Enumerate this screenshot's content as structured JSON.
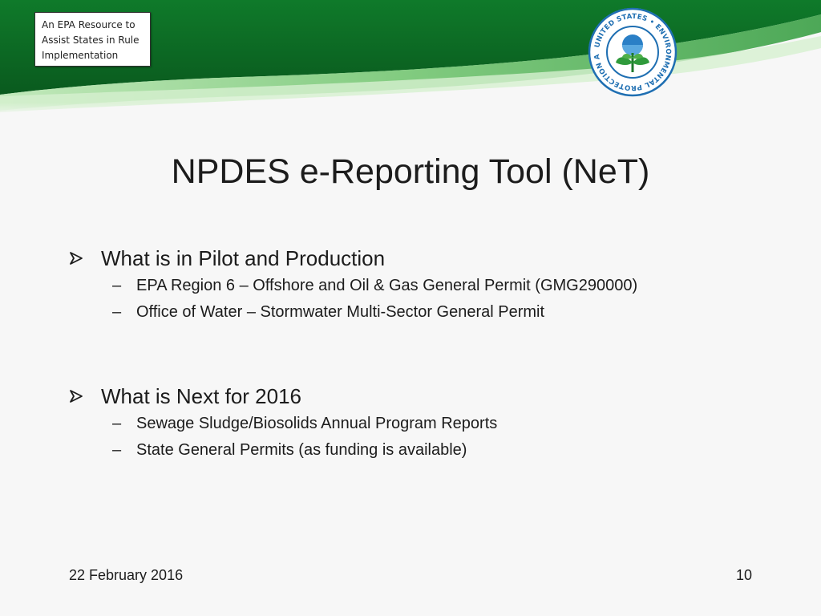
{
  "header": {
    "resource_note": {
      "line1": "An EPA Resource to",
      "line2": "Assist States in Rule",
      "line3": "Implementation"
    },
    "seal": {
      "ring_text": "UNITED STATES • ENVIRONMENTAL PROTECTION AGENCY •",
      "icon": "epa-seal-icon"
    },
    "colors": {
      "dark_green": "#0b5e20",
      "mid_green": "#2f9a3b",
      "light_green": "#8fd08a",
      "seal_blue": "#1f6fb2"
    }
  },
  "slide": {
    "title": "NPDES e-Reporting Tool (NeT)",
    "sections": [
      {
        "heading": "What is in Pilot and Production",
        "bullet_icon": "arrow-bullet-icon",
        "items": [
          "EPA Region 6 – Offshore and Oil & Gas General Permit (GMG290000)",
          "Office of Water – Stormwater Multi-Sector General Permit"
        ]
      },
      {
        "heading": "What is Next for 2016",
        "bullet_icon": "arrow-bullet-icon",
        "items": [
          "Sewage Sludge/Biosolids Annual Program Reports",
          "State General Permits (as funding is available)"
        ]
      }
    ],
    "dash": "–"
  },
  "footer": {
    "date": "22 February 2016",
    "page_number": "10"
  }
}
